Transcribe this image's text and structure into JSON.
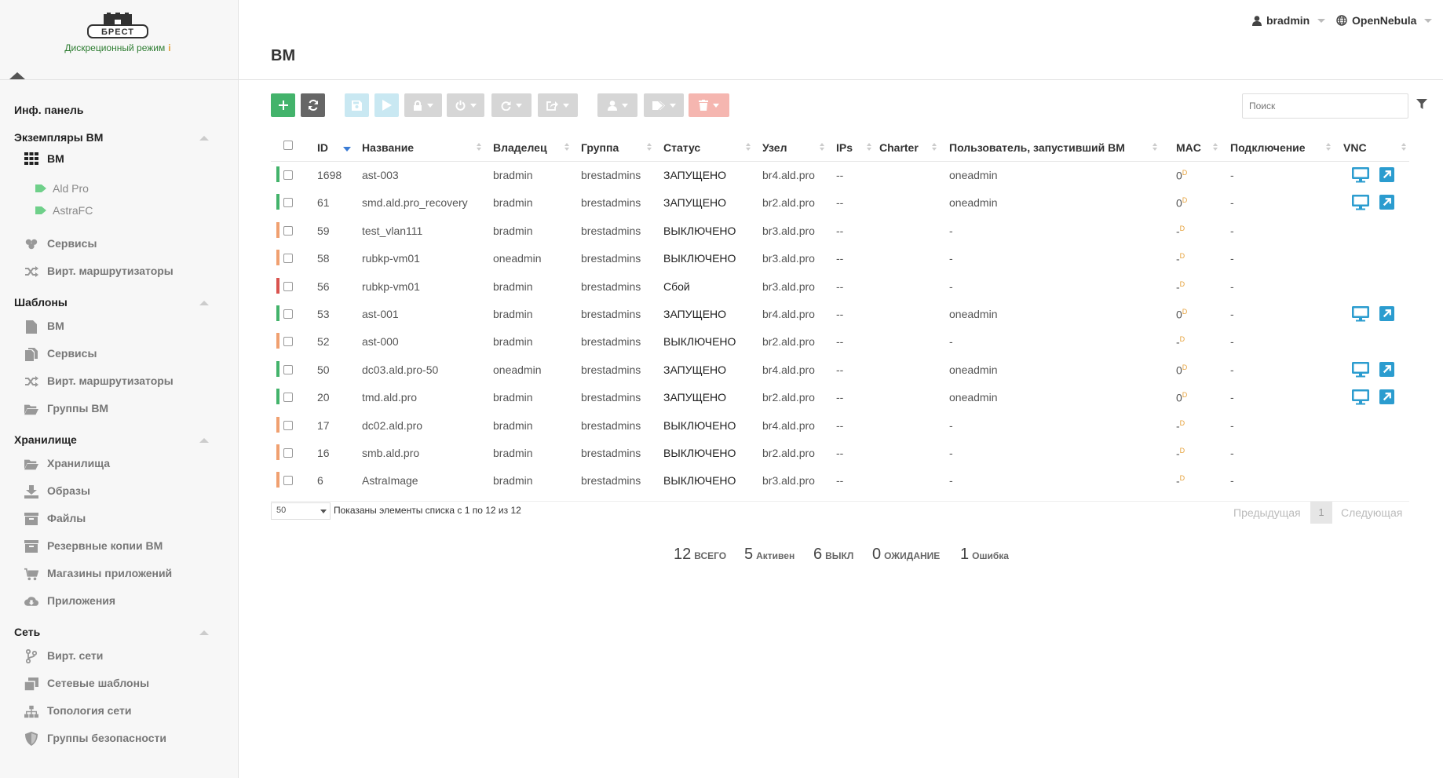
{
  "brand": {
    "logo_text": "БРЕСТ",
    "mode_label": "Дискреционный режим",
    "mode_info": "i"
  },
  "topbar": {
    "user": "bradmin",
    "zone": "OpenNebula"
  },
  "page_title": "ВМ",
  "sidebar": {
    "dashboard": "Инф. панель",
    "instances": {
      "title": "Экземпляры ВМ",
      "vm": "ВМ",
      "labels": [
        "Ald Pro",
        "AstraFC"
      ],
      "services": "Сервисы",
      "vrouters": "Вирт. маршрутизаторы"
    },
    "templates": {
      "title": "Шаблоны",
      "vm": "ВМ",
      "services": "Сервисы",
      "vrouters": "Вирт. маршрутизаторы",
      "vmgroups": "Группы ВМ"
    },
    "storage": {
      "title": "Хранилище",
      "datastores": "Хранилища",
      "images": "Образы",
      "files": "Файлы",
      "backups": "Резервные копии ВМ",
      "marketplaces": "Магазины приложений",
      "apps": "Приложения"
    },
    "network": {
      "title": "Сеть",
      "vnets": "Вирт. сети",
      "vnet_templates": "Сетевые шаблоны",
      "topology": "Топология сети",
      "secgroups": "Группы безопасности"
    }
  },
  "search": {
    "placeholder": "Поиск"
  },
  "table": {
    "columns": [
      "ID",
      "Название",
      "Владелец",
      "Группа",
      "Статус",
      "Узел",
      "IPs",
      "Charter",
      "Пользователь, запустивший ВМ",
      "MAC",
      "Подключение",
      "VNC"
    ],
    "rows": [
      {
        "id": "1698",
        "name": "ast-003",
        "owner": "bradmin",
        "group": "brestadmins",
        "status": "ЗАПУЩЕНО",
        "host": "br4.ald.pro",
        "ips": "--",
        "charter": "",
        "started_by": "oneadmin",
        "mac": "0",
        "conn": "-",
        "state": "running"
      },
      {
        "id": "61",
        "name": "smd.ald.pro_recovery",
        "owner": "bradmin",
        "group": "brestadmins",
        "status": "ЗАПУЩЕНО",
        "host": "br2.ald.pro",
        "ips": "--",
        "charter": "",
        "started_by": "oneadmin",
        "mac": "0",
        "conn": "-",
        "state": "running"
      },
      {
        "id": "59",
        "name": "test_vlan111",
        "owner": "bradmin",
        "group": "brestadmins",
        "status": "ВЫКЛЮЧЕНО",
        "host": "br3.ald.pro",
        "ips": "--",
        "charter": "",
        "started_by": "-",
        "mac": "-",
        "conn": "-",
        "state": "off"
      },
      {
        "id": "58",
        "name": "rubkp-vm01",
        "owner": "oneadmin",
        "group": "brestadmins",
        "status": "ВЫКЛЮЧЕНО",
        "host": "br3.ald.pro",
        "ips": "--",
        "charter": "",
        "started_by": "-",
        "mac": "-",
        "conn": "-",
        "state": "off"
      },
      {
        "id": "56",
        "name": "rubkp-vm01",
        "owner": "bradmin",
        "group": "brestadmins",
        "status": "Сбой",
        "host": "br3.ald.pro",
        "ips": "--",
        "charter": "",
        "started_by": "-",
        "mac": "-",
        "conn": "-",
        "state": "error"
      },
      {
        "id": "53",
        "name": "ast-001",
        "owner": "bradmin",
        "group": "brestadmins",
        "status": "ЗАПУЩЕНО",
        "host": "br4.ald.pro",
        "ips": "--",
        "charter": "",
        "started_by": "oneadmin",
        "mac": "0",
        "conn": "-",
        "state": "running"
      },
      {
        "id": "52",
        "name": "ast-000",
        "owner": "bradmin",
        "group": "brestadmins",
        "status": "ВЫКЛЮЧЕНО",
        "host": "br2.ald.pro",
        "ips": "--",
        "charter": "",
        "started_by": "-",
        "mac": "-",
        "conn": "-",
        "state": "off"
      },
      {
        "id": "50",
        "name": "dc03.ald.pro-50",
        "owner": "oneadmin",
        "group": "brestadmins",
        "status": "ЗАПУЩЕНО",
        "host": "br4.ald.pro",
        "ips": "--",
        "charter": "",
        "started_by": "oneadmin",
        "mac": "0",
        "conn": "-",
        "state": "running"
      },
      {
        "id": "20",
        "name": "tmd.ald.pro",
        "owner": "bradmin",
        "group": "brestadmins",
        "status": "ЗАПУЩЕНО",
        "host": "br2.ald.pro",
        "ips": "--",
        "charter": "",
        "started_by": "oneadmin",
        "mac": "0",
        "conn": "-",
        "state": "running"
      },
      {
        "id": "17",
        "name": "dc02.ald.pro",
        "owner": "bradmin",
        "group": "brestadmins",
        "status": "ВЫКЛЮЧЕНО",
        "host": "br4.ald.pro",
        "ips": "--",
        "charter": "",
        "started_by": "-",
        "mac": "-",
        "conn": "-",
        "state": "off"
      },
      {
        "id": "16",
        "name": "smb.ald.pro",
        "owner": "bradmin",
        "group": "brestadmins",
        "status": "ВЫКЛЮЧЕНО",
        "host": "br2.ald.pro",
        "ips": "--",
        "charter": "",
        "started_by": "-",
        "mac": "-",
        "conn": "-",
        "state": "off"
      },
      {
        "id": "6",
        "name": "AstraImage",
        "owner": "bradmin",
        "group": "brestadmins",
        "status": "ВЫКЛЮЧЕНО",
        "host": "br3.ald.pro",
        "ips": "--",
        "charter": "",
        "started_by": "-",
        "mac": "-",
        "conn": "-",
        "state": "off"
      }
    ],
    "mac_suffix": "D"
  },
  "colors": {
    "running": "#43b36b",
    "off": "#f0a070",
    "error": "#d9534f",
    "vnc": "#2b9ccf"
  },
  "footer": {
    "page_size": "50",
    "info": "Показаны элементы списка с 1 по 12 из 12",
    "prev": "Предыдущая",
    "page": "1",
    "next": "Следующая"
  },
  "stats": [
    {
      "value": "12",
      "label": "ВСЕГО"
    },
    {
      "value": "5",
      "label": "Активен"
    },
    {
      "value": "6",
      "label": "ВЫКЛ"
    },
    {
      "value": "0",
      "label": "ОЖИДАНИЕ"
    },
    {
      "value": "1",
      "label": "Ошибка"
    }
  ]
}
